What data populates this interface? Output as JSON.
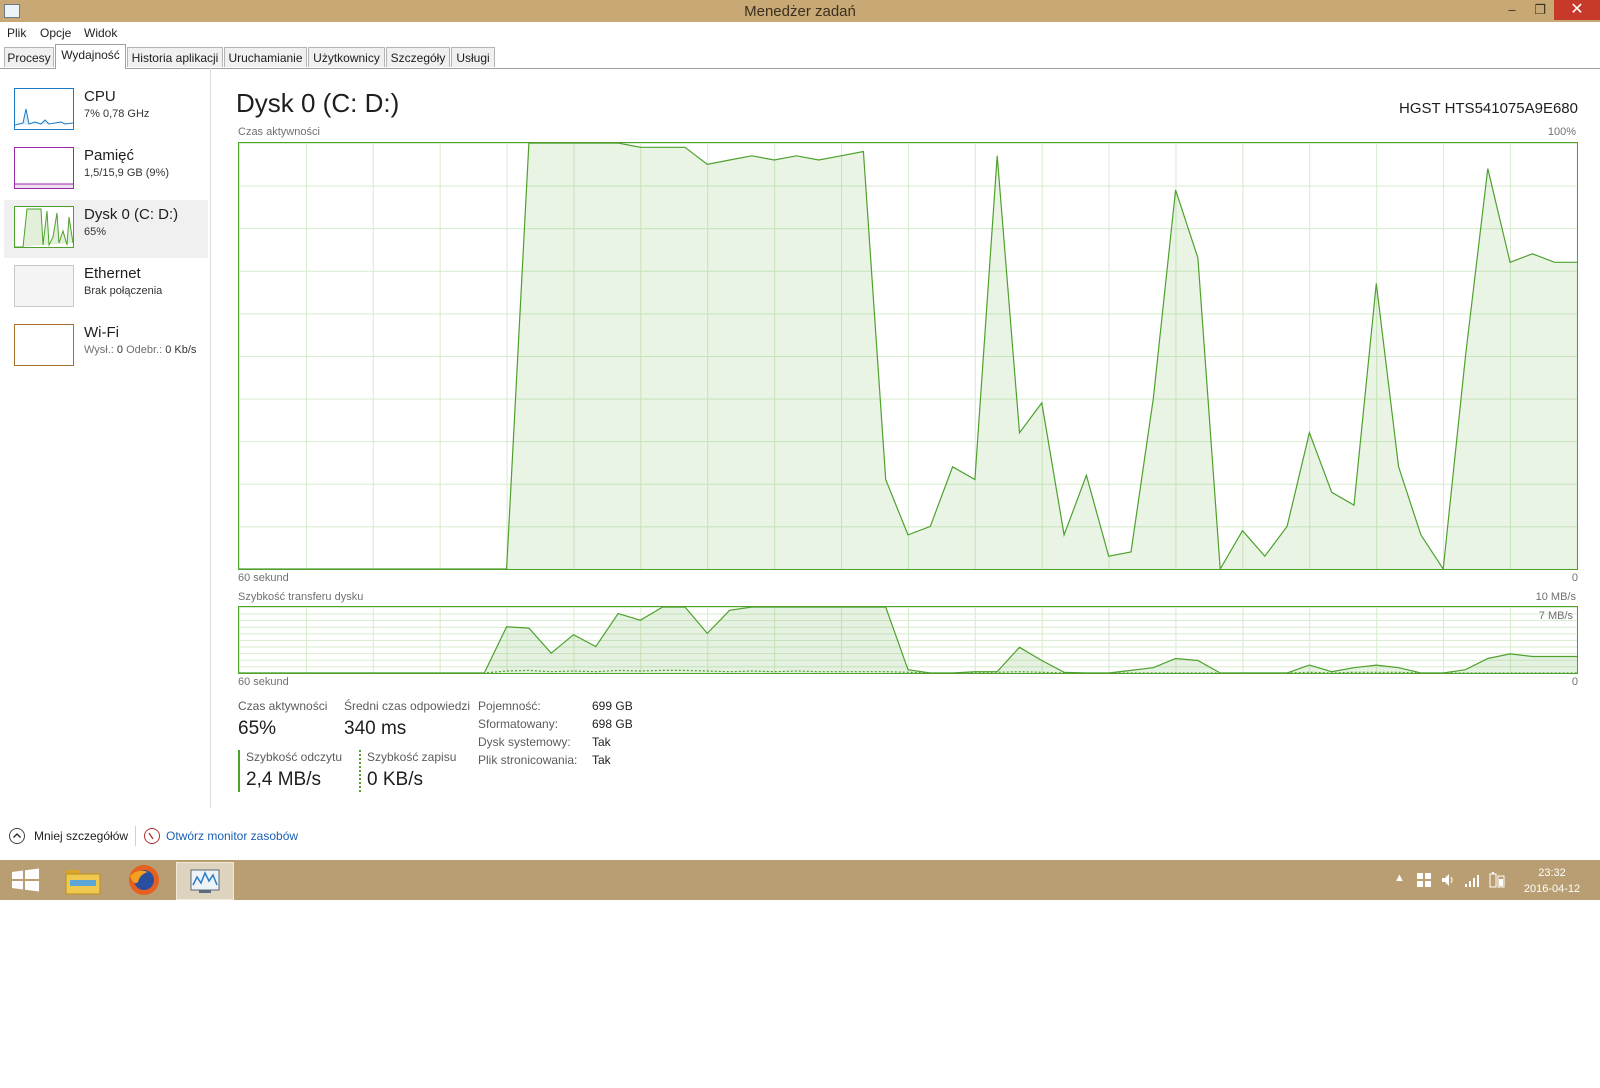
{
  "window": {
    "title": "Menedżer zadań",
    "min_glyph": "–",
    "max_glyph": "❐",
    "close_glyph": "✕"
  },
  "menu": [
    "Plik",
    "Opcje",
    "Widok"
  ],
  "tabs": [
    {
      "label": "Procesy"
    },
    {
      "label": "Wydajność",
      "active": true
    },
    {
      "label": "Historia aplikacji"
    },
    {
      "label": "Uruchamianie"
    },
    {
      "label": "Użytkownicy"
    },
    {
      "label": "Szczegóły"
    },
    {
      "label": "Usługi"
    }
  ],
  "sidebar": {
    "items": [
      {
        "title": "CPU",
        "sub": "7%  0,78 GHz",
        "color": "#1b7bc4"
      },
      {
        "title": "Pamięć",
        "sub": "1,5/15,9 GB (9%)",
        "color": "#9a2aa8"
      },
      {
        "title": "Dysk 0 (C: D:)",
        "sub": "65%",
        "color": "#4ea12d",
        "selected": true
      },
      {
        "title": "Ethernet",
        "sub": "Brak połączenia",
        "color": "#a57030"
      },
      {
        "title": "Wi-Fi",
        "sub_prefix": "Wysł.:",
        "sub_send": "0",
        "sub_mid": "Odebr.:",
        "sub_recv": "0 Kb/s",
        "color": "#a57030"
      }
    ]
  },
  "main": {
    "title": "Dysk 0 (C: D:)",
    "model": "HGST HTS541075A9E680",
    "activity_label": "Czas aktywności",
    "activity_max": "100%",
    "activity_x_left": "60 sekund",
    "activity_x_right": "0",
    "transfer_label": "Szybkość transferu dysku",
    "transfer_max": "10 MB/s",
    "transfer_mark": "7 MB/s",
    "transfer_x_left": "60 sekund",
    "transfer_x_right": "0"
  },
  "stats": {
    "active_time_label": "Czas aktywności",
    "active_time_value": "65%",
    "avg_response_label": "Średni czas odpowiedzi",
    "avg_response_value": "340 ms",
    "read_speed_label": "Szybkość odczytu",
    "read_speed_value": "2,4 MB/s",
    "write_speed_label": "Szybkość zapisu",
    "write_speed_value": "0 KB/s",
    "details": [
      {
        "key": "Pojemność:",
        "value": "699 GB"
      },
      {
        "key": "Sformatowany:",
        "value": "698 GB"
      },
      {
        "key": "Dysk systemowy:",
        "value": "Tak"
      },
      {
        "key": "Plik stronicowania:",
        "value": "Tak"
      }
    ]
  },
  "bottom": {
    "less_details": "Mniej szczegółów",
    "resource_monitor": "Otwórz monitor zasobów"
  },
  "taskbar": {
    "time": "23:32",
    "date": "2016-04-12"
  },
  "chart_data": [
    {
      "type": "area",
      "title": "Czas aktywności",
      "xlabel": "60 sekund",
      "ylim": [
        0,
        100
      ],
      "x": [
        60,
        59,
        58,
        57,
        56,
        55,
        54,
        53,
        52,
        51,
        50,
        49,
        48,
        47,
        46,
        45,
        44,
        43,
        42,
        41,
        40,
        39,
        38,
        37,
        36,
        35,
        34,
        33,
        32,
        31,
        30,
        29,
        28,
        27,
        26,
        25,
        24,
        23,
        22,
        21,
        20,
        19,
        18,
        17,
        16,
        15,
        14,
        13,
        12,
        11,
        10,
        9,
        8,
        7,
        6,
        5,
        4,
        3,
        2,
        1,
        0
      ],
      "values": [
        0,
        0,
        0,
        0,
        0,
        0,
        0,
        0,
        0,
        0,
        0,
        0,
        0,
        100,
        100,
        100,
        100,
        100,
        99,
        99,
        99,
        95,
        96,
        97,
        96,
        97,
        96,
        97,
        98,
        21,
        8,
        10,
        24,
        21,
        97,
        32,
        39,
        8,
        22,
        3,
        4,
        40,
        89,
        73,
        0,
        9,
        3,
        10,
        32,
        18,
        15,
        67,
        24,
        8,
        0,
        50,
        94,
        72,
        74,
        72,
        72
      ],
      "color": "#4ea12d"
    },
    {
      "type": "area",
      "title": "Szybkość transferu dysku",
      "xlabel": "60 sekund",
      "ylim": [
        0,
        10
      ],
      "unit": "MB/s",
      "series": [
        {
          "name": "Szybkość odczytu",
          "values": [
            0,
            0,
            0,
            0,
            0,
            0,
            0,
            0,
            0,
            0,
            0,
            0,
            7,
            6.8,
            3,
            5.8,
            4,
            9,
            8,
            10,
            10,
            6,
            9.5,
            10,
            10,
            10,
            10,
            10,
            10,
            10,
            0.5,
            0,
            0,
            0.2,
            0.2,
            3.9,
            1.9,
            0.1,
            0,
            0,
            0.4,
            0.8,
            2.2,
            1.9,
            0,
            0,
            0,
            0,
            1.2,
            0.2,
            0.8,
            1.2,
            0.8,
            0,
            0,
            0.5,
            2.2,
            2.9,
            2.5,
            2.5,
            2.5
          ]
        },
        {
          "name": "Szybkość zapisu",
          "values": [
            0,
            0,
            0,
            0,
            0,
            0,
            0,
            0,
            0,
            0,
            0,
            0,
            0.3,
            0.4,
            0.2,
            0.3,
            0.2,
            0.4,
            0.3,
            0.4,
            0.4,
            0.3,
            0.2,
            0.3,
            0.2,
            0.3,
            0.2,
            0.2,
            0.2,
            0.2,
            0.1,
            0,
            0,
            0.1,
            0.1,
            0.2,
            0.1,
            0,
            0,
            0,
            0,
            0,
            0,
            0,
            0,
            0,
            0,
            0,
            0.1,
            0,
            0.1,
            0.1,
            0.1,
            0,
            0,
            0,
            0,
            0,
            0,
            0,
            0
          ]
        }
      ],
      "color": "#4ea12d"
    }
  ]
}
